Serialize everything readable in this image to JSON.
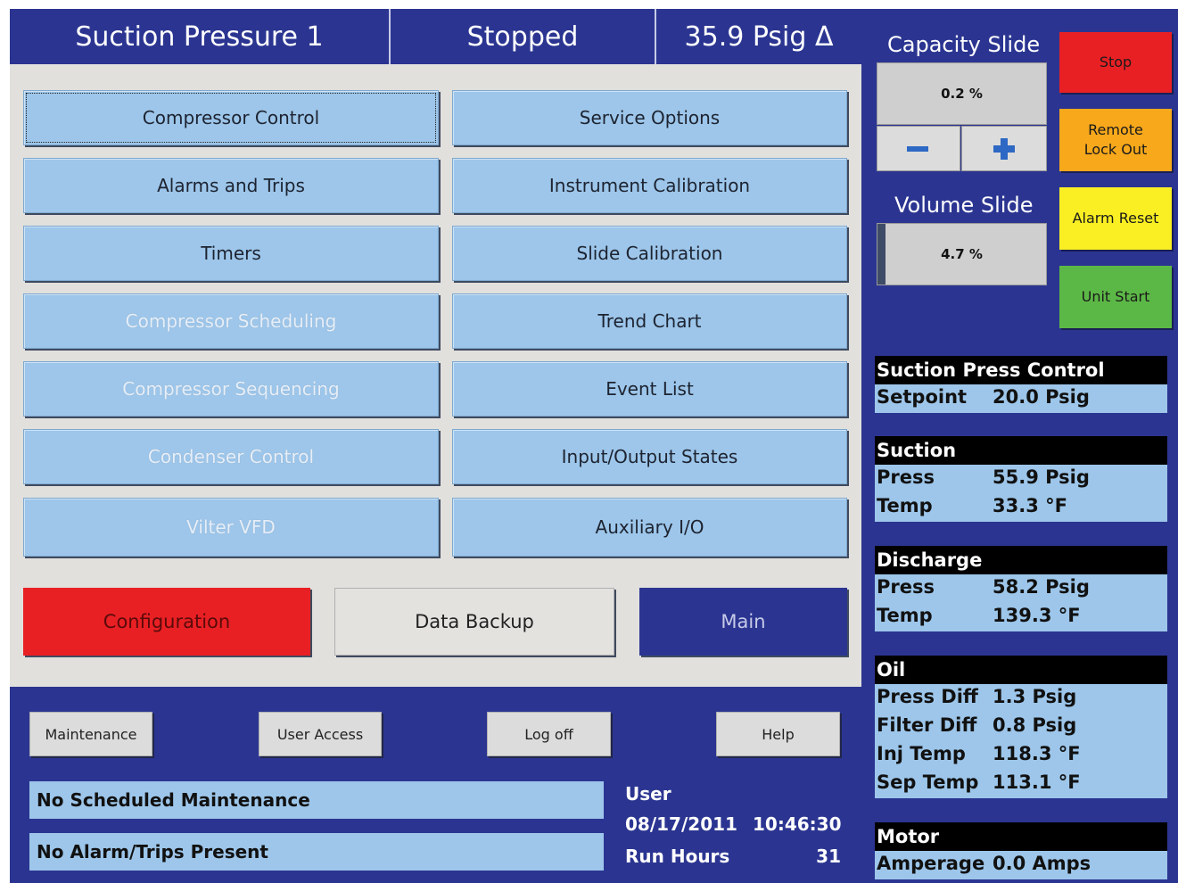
{
  "header": {
    "title": "Suction Pressure 1",
    "state": "Stopped",
    "reading": "35.9 Psig Δ"
  },
  "menu": {
    "left": [
      {
        "label": "Compressor Control",
        "enabled": true
      },
      {
        "label": "Alarms and Trips",
        "enabled": true
      },
      {
        "label": "Timers",
        "enabled": true
      },
      {
        "label": "Compressor Scheduling",
        "enabled": false
      },
      {
        "label": "Compressor Sequencing",
        "enabled": false
      },
      {
        "label": "Condenser Control",
        "enabled": false
      },
      {
        "label": "Vilter VFD",
        "enabled": false
      }
    ],
    "right": [
      {
        "label": "Service Options"
      },
      {
        "label": "Instrument Calibration"
      },
      {
        "label": "Slide Calibration"
      },
      {
        "label": "Trend Chart"
      },
      {
        "label": "Event List"
      },
      {
        "label": "Input/Output States"
      },
      {
        "label": "Auxiliary I/O"
      }
    ],
    "configuration": "Configuration",
    "data_backup": "Data Backup",
    "main": "Main"
  },
  "footer": {
    "maintenance": "Maintenance",
    "user_access": "User Access",
    "log_off": "Log off",
    "help": "Help",
    "maintenance_status": "No Scheduled Maintenance",
    "alarm_status": "No Alarm/Trips Present",
    "user_label": "User",
    "date": "08/17/2011",
    "time": "10:46:30",
    "run_hours_label": "Run Hours",
    "run_hours_value": "31"
  },
  "capacity_slide": {
    "title": "Capacity Slide",
    "value": "0.2 %",
    "fraction": 0.002
  },
  "volume_slide": {
    "title": "Volume Slide",
    "value": "4.7 %",
    "fraction": 0.047
  },
  "controls": {
    "stop": "Stop",
    "remote_lockout_1": "Remote",
    "remote_lockout_2": "Lock Out",
    "alarm_reset": "Alarm Reset",
    "unit_start": "Unit Start"
  },
  "sections": {
    "suction_control": {
      "title": "Suction Press Control",
      "setpoint_label": "Setpoint",
      "setpoint": "20.0 Psig"
    },
    "suction": {
      "title": "Suction",
      "press_label": "Press",
      "press": "55.9 Psig",
      "temp_label": "Temp",
      "temp": "33.3 °F"
    },
    "discharge": {
      "title": "Discharge",
      "press_label": "Press",
      "press": "58.2 Psig",
      "temp_label": "Temp",
      "temp": "139.3 °F"
    },
    "oil": {
      "title": "Oil",
      "press_diff_label": "Press Diff",
      "press_diff": "1.3 Psig",
      "filter_diff_label": "Filter Diff",
      "filter_diff": "0.8 Psig",
      "inj_temp_label": "Inj Temp",
      "inj_temp": "118.3 °F",
      "sep_temp_label": "Sep Temp",
      "sep_temp": "113.1 °F"
    },
    "motor": {
      "title": "Motor",
      "amperage_label": "Amperage",
      "amperage": "0.0 Amps"
    }
  },
  "colors": {
    "background": "#2b3591",
    "panel": "#e1e0dd",
    "button": "#9dc6ea",
    "stop": "#e82024",
    "remote": "#f7a81b",
    "alarm_reset": "#f9ef23",
    "unit_start": "#5cb846"
  }
}
